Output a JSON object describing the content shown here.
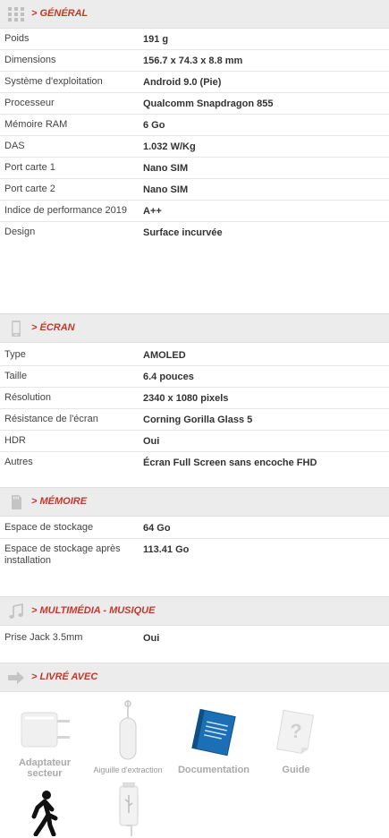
{
  "general": {
    "title": "> GÉNÉRAL",
    "rows": [
      {
        "label": "Poids",
        "value": "191 g"
      },
      {
        "label": "Dimensions",
        "value": "156.7 x 74.3 x 8.8 mm"
      },
      {
        "label": "Système d'exploitation",
        "value": "Android 9.0 (Pie)"
      },
      {
        "label": "Processeur",
        "value": "Qualcomm Snapdragon 855"
      },
      {
        "label": "Mémoire RAM",
        "value": "6 Go"
      },
      {
        "label": "DAS",
        "value": "1.032 W/Kg"
      },
      {
        "label": "Port carte 1",
        "value": "Nano SIM"
      },
      {
        "label": "Port carte 2",
        "value": "Nano SIM"
      },
      {
        "label": "Indice de performance 2019",
        "value": "A++"
      },
      {
        "label": "Design",
        "value": "Surface incurvée"
      }
    ]
  },
  "ecran": {
    "title": "> ÉCRAN",
    "rows": [
      {
        "label": "Type",
        "value": "AMOLED"
      },
      {
        "label": "Taille",
        "value": "6.4 pouces"
      },
      {
        "label": "Résolution",
        "value": "2340 x 1080 pixels"
      },
      {
        "label": "Résistance de l'écran",
        "value": "Corning Gorilla Glass 5"
      },
      {
        "label": "HDR",
        "value": "Oui"
      },
      {
        "label": "Autres",
        "value": "Écran Full Screen sans encoche FHD"
      }
    ]
  },
  "memoire": {
    "title": "> MÉMOIRE",
    "rows": [
      {
        "label": "Espace de stockage",
        "value": "64 Go"
      },
      {
        "label": "Espace de stockage après installation",
        "value": "113.41 Go"
      }
    ]
  },
  "multimedia": {
    "title": "> MULTIMÉDIA - MUSIQUE",
    "rows": [
      {
        "label": "Prise Jack 3.5mm",
        "value": "Oui"
      }
    ]
  },
  "livre": {
    "title": "> LIVRÉ AVEC",
    "items": [
      {
        "label": "Adaptateur secteur",
        "icon": "power-adapter-icon"
      },
      {
        "label": "Aiguille d'extraction",
        "icon": "sim-ejector-icon"
      },
      {
        "label": "Documentation",
        "icon": "documentation-icon"
      },
      {
        "label": "Guide",
        "icon": "guide-icon"
      },
      {
        "label": "",
        "icon": "walking-person-icon"
      },
      {
        "label": "",
        "icon": "usb-cable-icon"
      }
    ]
  },
  "colors": {
    "accent": "#c0392b",
    "header_bg": "#ececec",
    "doc_blue": "#1a6fb5"
  }
}
